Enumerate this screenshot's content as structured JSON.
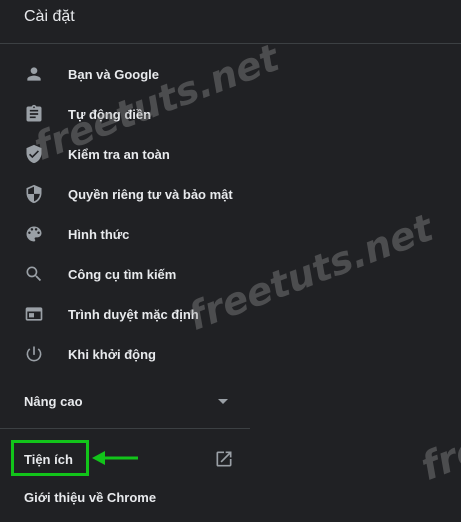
{
  "header": {
    "title": "Cài đặt"
  },
  "nav": {
    "items": [
      {
        "label": "Bạn và Google",
        "icon": "person-icon"
      },
      {
        "label": "Tự động điền",
        "icon": "clipboard-icon"
      },
      {
        "label": "Kiểm tra an toàn",
        "icon": "shield-check-icon"
      },
      {
        "label": "Quyền riêng tư và bảo mật",
        "icon": "shield-icon"
      },
      {
        "label": "Hình thức",
        "icon": "palette-icon"
      },
      {
        "label": "Công cụ tìm kiếm",
        "icon": "search-icon"
      },
      {
        "label": "Trình duyệt mặc định",
        "icon": "browser-icon"
      },
      {
        "label": "Khi khởi động",
        "icon": "power-icon"
      }
    ]
  },
  "advanced": {
    "label": "Nâng cao"
  },
  "extensions": {
    "label": "Tiện ích",
    "icon": "open-in-new-icon"
  },
  "about": {
    "label": "Giới thiệu về Chrome"
  },
  "watermark": {
    "text": "freetuts.net",
    "partial": "free"
  },
  "colors": {
    "background": "#202124",
    "text": "#e8eaed",
    "icon": "#9aa0a6",
    "highlight": "#12c41a"
  }
}
